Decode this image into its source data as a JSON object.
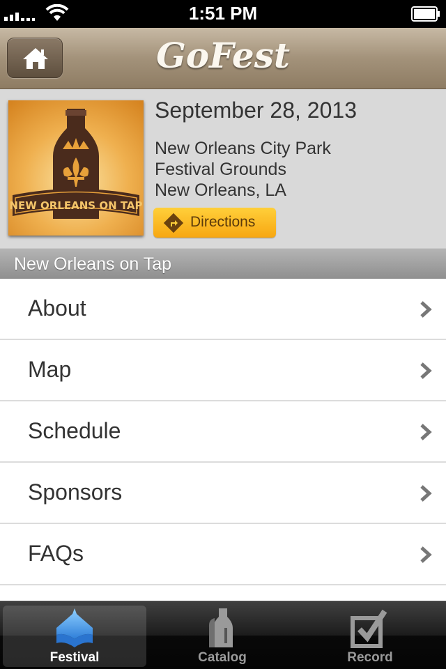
{
  "status_bar": {
    "time": "1:51 PM"
  },
  "nav": {
    "title": "GoFest",
    "home_icon": "home-icon"
  },
  "event": {
    "logo_text": "NEW ORLEANS ON TAP",
    "date": "September 28, 2013",
    "venue": [
      "New Orleans City Park",
      "Festival Grounds",
      "New Orleans, LA"
    ],
    "directions_label": "Directions"
  },
  "section_title": "New Orleans on Tap",
  "menu": [
    {
      "label": "About"
    },
    {
      "label": "Map"
    },
    {
      "label": "Schedule"
    },
    {
      "label": "Sponsors"
    },
    {
      "label": "FAQs"
    }
  ],
  "tabs": [
    {
      "label": "Festival",
      "icon": "tent-icon",
      "active": true
    },
    {
      "label": "Catalog",
      "icon": "bottle-icon",
      "active": false
    },
    {
      "label": "Record",
      "icon": "checkbox-icon",
      "active": false
    }
  ],
  "colors": {
    "accent": "#f7a712",
    "nav": "#a3927a",
    "active_tab": "#4a9be8"
  }
}
